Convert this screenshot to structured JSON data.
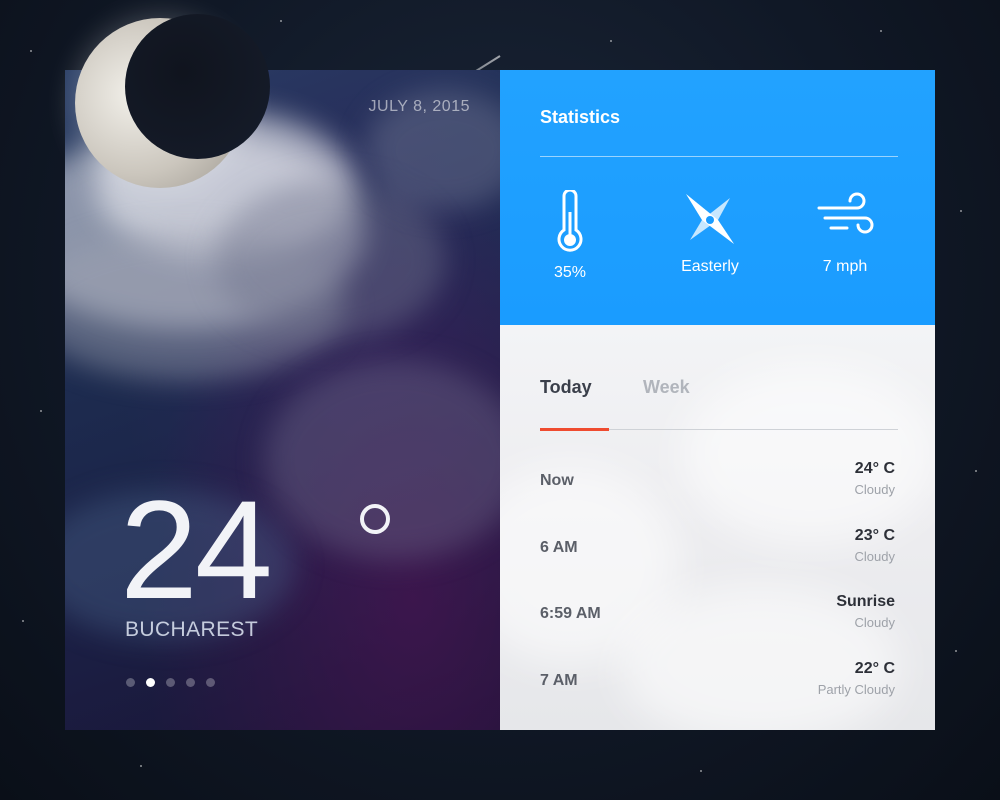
{
  "left_panel": {
    "date": "JULY 8, 2015",
    "temperature": "24",
    "city": "BUCHAREST",
    "pagination": {
      "total": 5,
      "active_index": 1
    }
  },
  "statistics": {
    "title": "Statistics",
    "items": [
      {
        "icon": "thermometer-icon",
        "label": "35%"
      },
      {
        "icon": "compass-icon",
        "label": "Easterly"
      },
      {
        "icon": "wind-icon",
        "label": "7 mph"
      }
    ]
  },
  "forecast": {
    "tabs": [
      {
        "label": "Today",
        "active": true
      },
      {
        "label": "Week",
        "active": false
      }
    ],
    "rows": [
      {
        "time": "Now",
        "value": "24° C",
        "condition": "Cloudy"
      },
      {
        "time": "6 AM",
        "value": "23° C",
        "condition": "Cloudy"
      },
      {
        "time": "6:59 AM",
        "value": "Sunrise",
        "condition": "Cloudy"
      },
      {
        "time": "7 AM",
        "value": "22° C",
        "condition": "Partly Cloudy"
      }
    ]
  },
  "colors": {
    "accent_blue": "#1a9cff",
    "tab_indicator": "#ef4b2f",
    "forecast_bg": "#ededf0"
  }
}
